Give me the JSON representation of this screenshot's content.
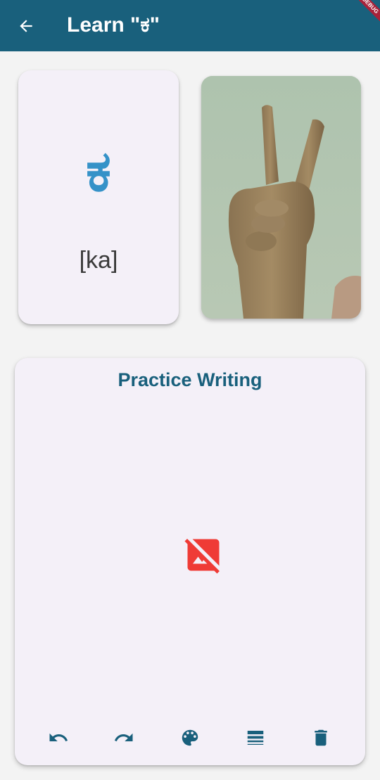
{
  "app_bar": {
    "title": "Learn \"ಕ\"",
    "back_icon": "arrow-back-icon",
    "background": "#19607c",
    "debug_banner": "DEBUG"
  },
  "letter_card": {
    "glyph": "ಕ",
    "phonetic": "[ka]",
    "glyph_color": "#3592c8"
  },
  "sign_image": {
    "description_icon": "hand-sign-image"
  },
  "practice": {
    "title": "Practice Writing",
    "placeholder_icon": "broken-image-icon",
    "placeholder_color": "#ef3b36",
    "tools": [
      {
        "name": "undo",
        "icon": "undo-icon"
      },
      {
        "name": "redo",
        "icon": "redo-icon"
      },
      {
        "name": "color",
        "icon": "palette-icon"
      },
      {
        "name": "stroke-width",
        "icon": "line-weight-icon"
      },
      {
        "name": "clear",
        "icon": "delete-icon"
      }
    ]
  }
}
